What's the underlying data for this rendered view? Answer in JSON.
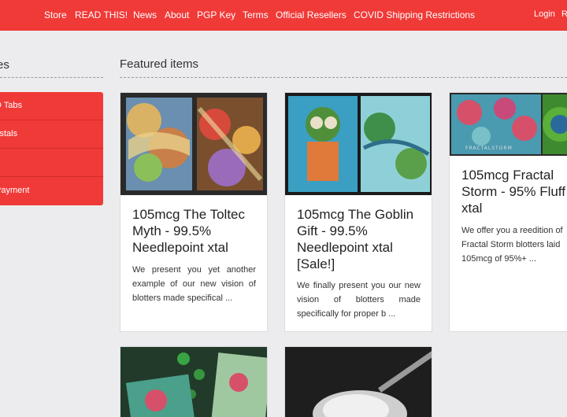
{
  "nav": {
    "links": [
      "Store",
      "READ THIS!",
      "News",
      "About",
      "PGP Key",
      "Terms",
      "Official Resellers",
      "COVID Shipping Restrictions"
    ],
    "right": [
      "Login",
      "R"
    ]
  },
  "sidebar": {
    "title": "es",
    "items": [
      "D Tabs",
      "ystals",
      "",
      "Payment"
    ]
  },
  "main": {
    "title": "Featured items",
    "cards": [
      {
        "title": "105mcg The Toltec Myth - 99.5% Needlepoint xtal",
        "desc": "We present you yet another example of our new vision of blotters made specifical ..."
      },
      {
        "title": "105mcg The Goblin Gift - 99.5% Needlepoint xtal [Sale!]",
        "desc": "We finally present you our new vision of blotters made specifically for proper b ..."
      },
      {
        "title": "105mcg Fractal Storm - 95% Fluff xtal",
        "desc": "We offer you a reedition of Fractal Storm blotters laid 105mcg of 95%+ ...",
        "image_label": "FRACTALSTORM"
      },
      {
        "title": "",
        "desc": ""
      },
      {
        "title": "",
        "desc": ""
      }
    ]
  },
  "colors": {
    "accent": "#f03a38",
    "background": "#ececee"
  }
}
